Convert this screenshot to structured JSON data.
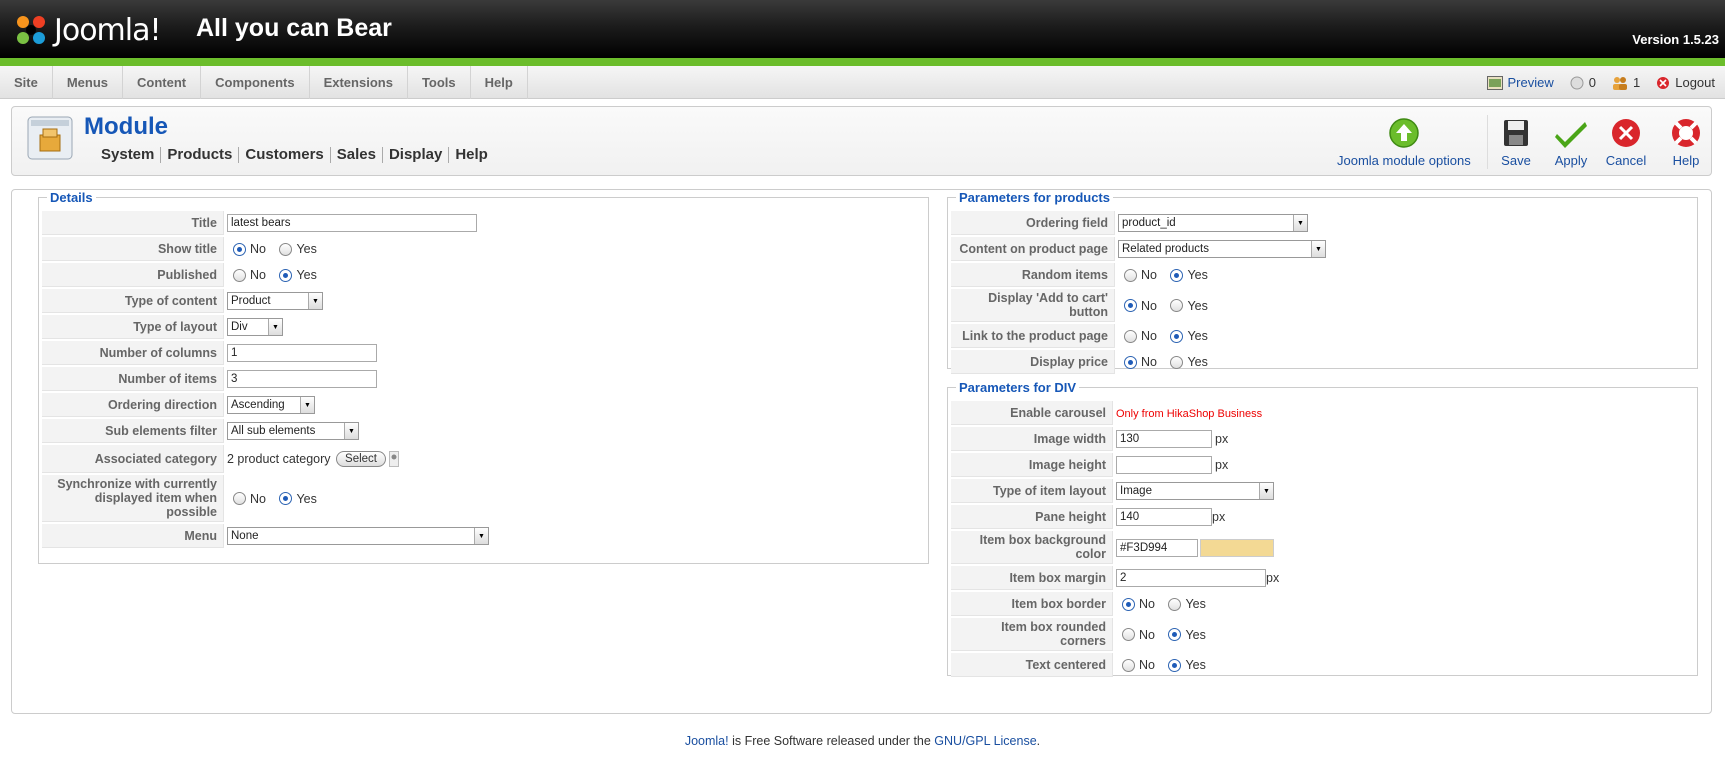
{
  "header": {
    "logo_text": "Joomla!",
    "site_title": "All you can Bear",
    "version": "Version 1.5.23"
  },
  "menu": {
    "items": [
      "Site",
      "Menus",
      "Content",
      "Components",
      "Extensions",
      "Tools",
      "Help"
    ]
  },
  "status": {
    "preview": "Preview",
    "messages_count": "0",
    "users_count": "1",
    "logout": "Logout"
  },
  "toolbar": {
    "page_title": "Module",
    "submenu": [
      "System",
      "Products",
      "Customers",
      "Sales",
      "Display",
      "Help"
    ],
    "buttons": {
      "joomla_options": "Joomla module options",
      "save": "Save",
      "apply": "Apply",
      "cancel": "Cancel",
      "help": "Help"
    }
  },
  "details": {
    "legend": "Details",
    "title_label": "Title",
    "title_value": "latest bears",
    "show_title_label": "Show title",
    "show_title_value": "No",
    "published_label": "Published",
    "published_value": "Yes",
    "type_of_content_label": "Type of content",
    "type_of_content_value": "Product",
    "type_of_layout_label": "Type of layout",
    "type_of_layout_value": "Div",
    "number_of_columns_label": "Number of columns",
    "number_of_columns_value": "1",
    "number_of_items_label": "Number of items",
    "number_of_items_value": "3",
    "ordering_direction_label": "Ordering direction",
    "ordering_direction_value": "Ascending",
    "sub_elements_filter_label": "Sub elements filter",
    "sub_elements_filter_value": "All sub elements",
    "associated_category_label": "Associated category",
    "associated_category_value": "2 product category",
    "select_button": "Select",
    "synchronize_label_1": "Synchronize with currently",
    "synchronize_label_2": "displayed item when possible",
    "synchronize_value": "Yes",
    "menu_label": "Menu",
    "menu_value": "None",
    "no_label": "No",
    "yes_label": "Yes"
  },
  "products_params": {
    "legend": "Parameters for products",
    "ordering_field_label": "Ordering field",
    "ordering_field_value": "product_id",
    "content_on_product_page_label": "Content on product page",
    "content_on_product_page_value": "Related products",
    "random_items_label": "Random items",
    "random_items_value": "Yes",
    "add_to_cart_label": "Display 'Add to cart' button",
    "add_to_cart_value": "No",
    "link_to_product_label": "Link to the product page",
    "link_to_product_value": "Yes",
    "display_price_label": "Display price",
    "display_price_value": "No"
  },
  "div_params": {
    "legend": "Parameters for DIV",
    "enable_carousel_label": "Enable carousel",
    "enable_carousel_note": "Only from HikaShop Business",
    "image_width_label": "Image width",
    "image_width_value": "130",
    "image_height_label": "Image height",
    "image_height_value": "",
    "type_of_item_layout_label": "Type of item layout",
    "type_of_item_layout_value": "Image",
    "pane_height_label": "Pane height",
    "pane_height_value": "140",
    "item_box_bg_label": "Item box background color",
    "item_box_bg_value": "#F3D994",
    "item_box_margin_label": "Item box margin",
    "item_box_margin_value": "2",
    "item_box_border_label": "Item box border",
    "item_box_border_value": "No",
    "rounded_corners_label": "Item box rounded corners",
    "rounded_corners_value": "Yes",
    "text_centered_label": "Text centered",
    "text_centered_value": "Yes",
    "px_unit": "px"
  },
  "footer": {
    "joomla_link": "Joomla!",
    "middle_text": " is Free Software released under the ",
    "license_link": "GNU/GPL License",
    "end": "."
  },
  "colors": {
    "accent_green": "#6bbd2b",
    "link_blue": "#1657b7",
    "swatch": "#F3D994"
  }
}
